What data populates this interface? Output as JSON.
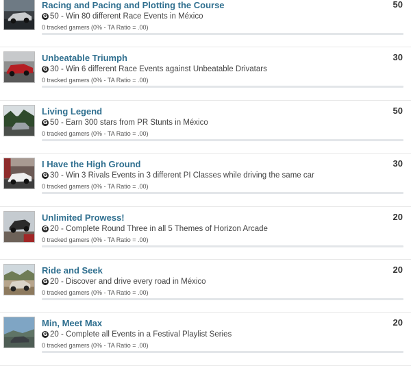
{
  "achievements": [
    {
      "title": "Racing and Pacing and Plotting the Course",
      "gamerscore": "50",
      "description": "50 - Win 80 different Race Events in México",
      "tracked": "0 tracked gamers (0% - TA Ratio = .00)",
      "progress_fraction": 0,
      "icon": "gamerscore-icon",
      "thumbnail": "race-car-thumbnail"
    },
    {
      "title": "Unbeatable Triumph",
      "gamerscore": "30",
      "description": "30 - Win 6 different Race Events against Unbeatable Drivatars",
      "tracked": "0 tracked gamers (0% - TA Ratio = .00)",
      "progress_fraction": 0,
      "icon": "gamerscore-icon",
      "thumbnail": "red-car-thumbnail"
    },
    {
      "title": "Living Legend",
      "gamerscore": "50",
      "description": "50 - Earn 300 stars from PR Stunts in México",
      "tracked": "0 tracked gamers (0% - TA Ratio = .00)",
      "progress_fraction": 0,
      "icon": "gamerscore-icon",
      "thumbnail": "jungle-car-thumbnail"
    },
    {
      "title": "I Have the High Ground",
      "gamerscore": "30",
      "description": "30 - Win 3 Rivals Events in 3 different PI Classes while driving the same car",
      "tracked": "0 tracked gamers (0% - TA Ratio = .00)",
      "progress_fraction": 0,
      "icon": "gamerscore-icon",
      "thumbnail": "white-car-thumbnail"
    },
    {
      "title": "Unlimited Prowess!",
      "gamerscore": "20",
      "description": "20 - Complete Round Three in all 5 Themes of Horizon Arcade",
      "tracked": "0 tracked gamers (0% - TA Ratio = .00)",
      "progress_fraction": 0,
      "icon": "gamerscore-icon",
      "thumbnail": "jumping-car-thumbnail"
    },
    {
      "title": "Ride and Seek",
      "gamerscore": "20",
      "description": "20 - Discover and drive every road in México",
      "tracked": "0 tracked gamers (0% - TA Ratio = .00)",
      "progress_fraction": 0,
      "icon": "gamerscore-icon",
      "thumbnail": "offroad-car-thumbnail"
    },
    {
      "title": "Min, Meet Max",
      "gamerscore": "20",
      "description": "20 - Complete all Events in a Festival Playlist Series",
      "tracked": "0 tracked gamers (0% - TA Ratio = .00)",
      "progress_fraction": 0,
      "icon": "gamerscore-icon",
      "thumbnail": "sky-car-thumbnail"
    }
  ],
  "colors": {
    "title": "#2f6f8f",
    "bar_track": "#e3e6e9",
    "bar_fill": "#3a86b4"
  }
}
